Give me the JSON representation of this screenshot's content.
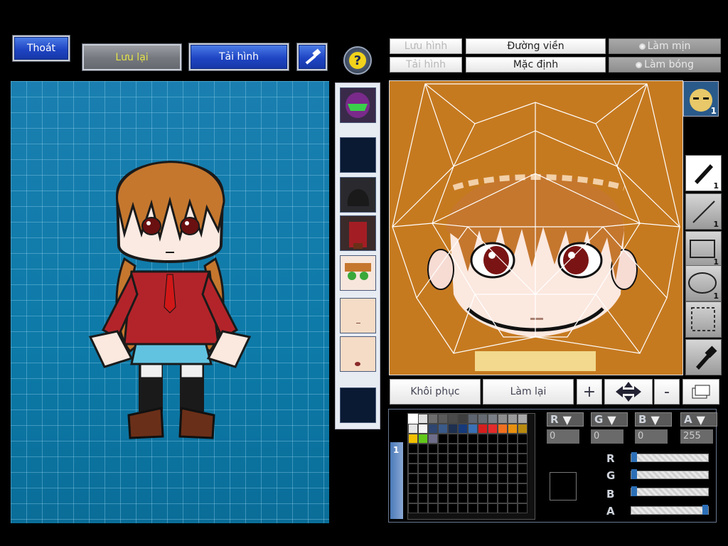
{
  "top_toolbar": {
    "exit_label": "Thoát",
    "save_label": "Lưu lại",
    "load_label": "Tải hình",
    "help_symbol": "?"
  },
  "editor_toolbar": {
    "save_image_label": "Lưu hình",
    "load_image_label": "Tải hình",
    "outline_label": "Đường viền",
    "default_label": "Mặc định",
    "smooth_label": "Làm mịn",
    "shine_label": "Làm bóng"
  },
  "side_badge_count": "1",
  "tools": [
    {
      "name": "pen",
      "count": "1"
    },
    {
      "name": "line",
      "count": "1"
    },
    {
      "name": "rectangle",
      "count": "1"
    },
    {
      "name": "ellipse",
      "count": "1"
    },
    {
      "name": "selection",
      "count": ""
    },
    {
      "name": "eyedropper",
      "count": ""
    }
  ],
  "edit_actions": {
    "restore_label": "Khôi phục",
    "redo_label": "Làm lại",
    "zoom_in_symbol": "+",
    "zoom_out_symbol": "-"
  },
  "palette": {
    "tab_label": "1",
    "colors": [
      "#ffffff",
      "#e0e0e0",
      "#6e6e6e",
      "#5a5a5a",
      "#4a4a4a",
      "#3e3e3e",
      "#5e6470",
      "#666a72",
      "#7a7e86",
      "#8e8e8e",
      "#9a9a9a",
      "#a8a8a8",
      "#e6e6e6",
      "#f4f4f4",
      "#2e4670",
      "#3a5a8a",
      "#1e3050",
      "#163a7a",
      "#3a70b4",
      "#d41e1e",
      "#e22b2b",
      "#f07020",
      "#e89010",
      "#b88a10",
      "#f2c000",
      "#62c81a",
      "#6e6e8a"
    ]
  },
  "color_channels": {
    "r": {
      "label": "R",
      "value": "0",
      "fraction": 0
    },
    "g": {
      "label": "G",
      "value": "0",
      "fraction": 0
    },
    "b": {
      "label": "B",
      "value": "0",
      "fraction": 0
    },
    "a": {
      "label": "A",
      "value": "255",
      "fraction": 1
    }
  },
  "colors": {
    "stage_bg": "#1386b3",
    "editor_bg": "#c67a20",
    "accent_blue": "#1f45c4"
  }
}
